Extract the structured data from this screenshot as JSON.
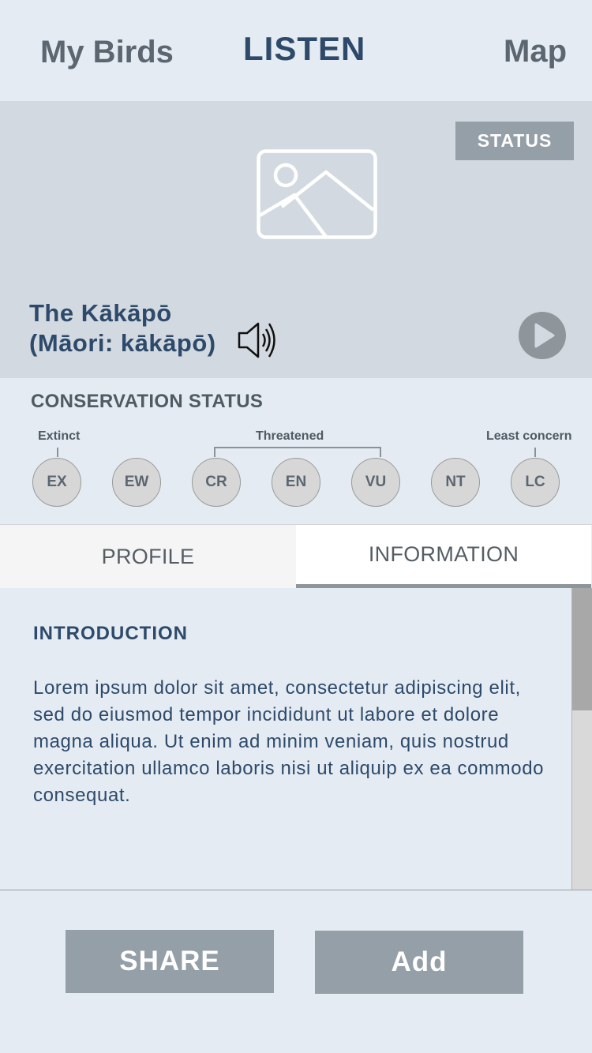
{
  "nav": {
    "my_birds": "My Birds",
    "listen": "LISTEN",
    "map": "Map"
  },
  "hero": {
    "status_label": "STATUS",
    "bird_name_line1": "The Kākāpō",
    "bird_name_line2": "(Māori: kākāpō)",
    "image_icon": "image-placeholder-icon",
    "speaker_icon": "speaker-icon",
    "play_icon": "play-icon"
  },
  "conservation": {
    "title": "CONSERVATION STATUS",
    "labels": {
      "extinct": "Extinct",
      "threatened": "Threatened",
      "least_concern": "Least concern"
    },
    "levels": [
      "EX",
      "EW",
      "CR",
      "EN",
      "VU",
      "NT",
      "LC"
    ]
  },
  "tabs": {
    "profile": "PROFILE",
    "information": "INFORMATION",
    "active": "information"
  },
  "content": {
    "intro_title": "INTRODUCTION",
    "intro_body": "Lorem ipsum dolor sit amet, consectetur adipiscing elit, sed do eiusmod tempor incididunt ut labore et dolore magna aliqua. Ut enim ad minim veniam, quis nostrud exercitation ullamco laboris nisi ut aliquip ex ea commodo consequat."
  },
  "actions": {
    "share": "SHARE",
    "add": "Add"
  },
  "colors": {
    "background": "#e4ebf2",
    "hero_bg": "#d2d9e0",
    "accent_dark": "#2e4a6a",
    "button_gray": "#949fa8",
    "text_gray": "#5c6670"
  }
}
